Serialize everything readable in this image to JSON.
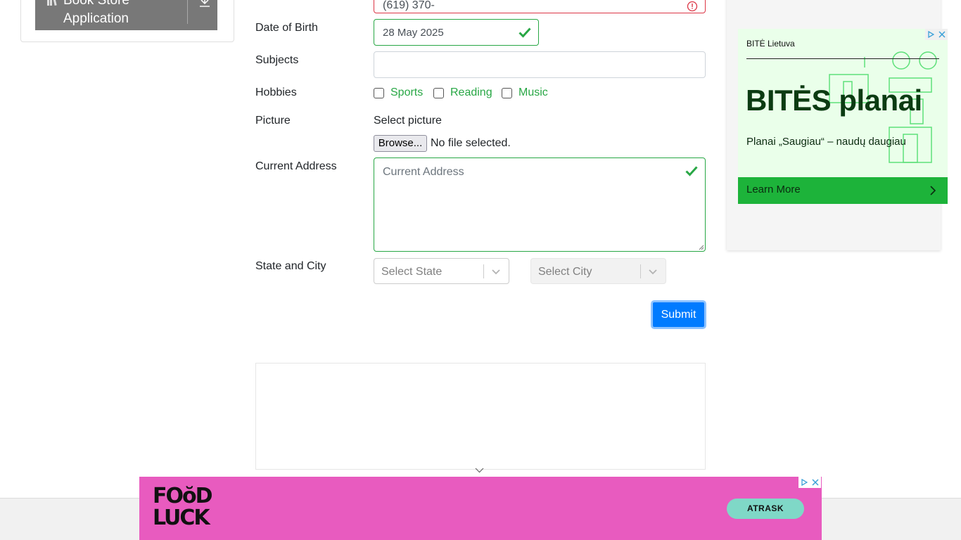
{
  "sidebar": {
    "app_title_line1": "Book Store",
    "app_title_line2": "Application"
  },
  "form": {
    "mobile_value": "(619) 370-",
    "dob_label": "Date of Birth",
    "dob_value": "28 May 2025",
    "subjects_label": "Subjects",
    "subjects_value": "",
    "hobbies_label": "Hobbies",
    "hobbies": [
      "Sports",
      "Reading",
      "Music"
    ],
    "picture_label": "Picture",
    "select_picture": "Select picture",
    "browse_label": "Browse...",
    "no_file": "No file selected.",
    "address_label": "Current Address",
    "address_placeholder": "Current Address",
    "state_city_label": "State and City",
    "state_placeholder": "Select State",
    "city_placeholder": "Select City",
    "submit_label": "Submit"
  },
  "right_ad": {
    "brand": "BITĖ Lietuva",
    "headline": "BITĖS planai",
    "tagline": "Planai „Saugiau“ – naudų daugiau",
    "cta": "Learn More",
    "accent_color": "#1db33a"
  },
  "bottom_ad": {
    "logo_line1": "FOŏD",
    "logo_line2": "LUCK",
    "cta": "ATRASK",
    "bg_color": "#e85bbf"
  },
  "colors": {
    "valid": "#28a745",
    "invalid": "#dc3545",
    "primary": "#007bff"
  }
}
